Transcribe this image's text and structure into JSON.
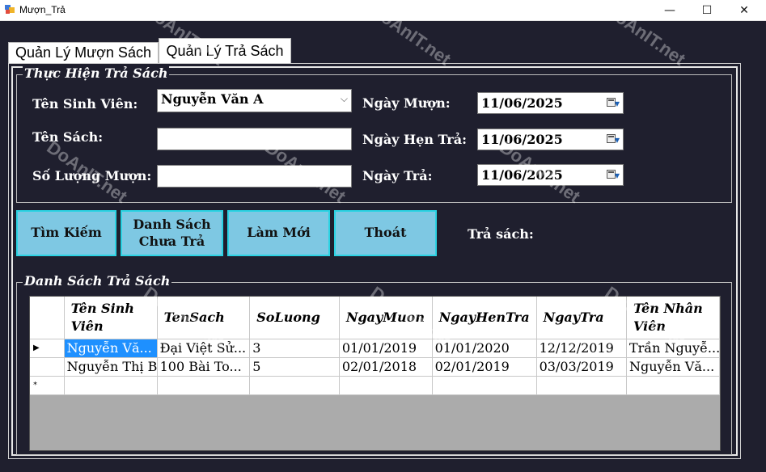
{
  "window": {
    "title": "Mượn_Trả",
    "minimize": "—",
    "maximize": "☐",
    "close": "✕"
  },
  "tabs": [
    {
      "label": "Quản Lý Mượn Sách"
    },
    {
      "label": "Quản Lý Trả Sách"
    }
  ],
  "return_group": {
    "legend": "Thực Hiện Trả Sách",
    "student_label": "Tên Sinh Viên:",
    "student_value": "Nguyễn Văn A",
    "book_label": "Tên Sách:",
    "book_value": "",
    "qty_label": "Số Lượng Mượn:",
    "qty_value": "",
    "borrow_date_label": "Ngày Mượn:",
    "borrow_date_value": "11/06/2025",
    "due_date_label": "Ngày Hẹn Trả:",
    "due_date_value": "11/06/2025",
    "return_date_label": "Ngày Trả:",
    "return_date_value": "11/06/2025"
  },
  "buttons": {
    "search": "Tìm Kiếm",
    "unreturned_line1": "Danh Sách",
    "unreturned_line2": "Chưa Trả",
    "refresh": "Làm Mới",
    "exit": "Thoát",
    "return_label": "Trả sách:"
  },
  "list_group": {
    "legend": "Danh Sách Trả Sách",
    "columns": [
      {
        "line1": "Tên Sinh",
        "line2": "Viên"
      },
      {
        "line1": "TenSach",
        "line2": ""
      },
      {
        "line1": "SoLuong",
        "line2": ""
      },
      {
        "line1": "NgayMuon",
        "line2": ""
      },
      {
        "line1": "NgayHenTra",
        "line2": ""
      },
      {
        "line1": "NgayTra",
        "line2": ""
      },
      {
        "line1": "Tên Nhân",
        "line2": "Viên"
      }
    ],
    "rows": [
      [
        "Nguyễn Vă...",
        "Đại Việt Sử...",
        "3",
        "01/01/2019",
        "01/01/2020",
        "12/12/2019",
        "Trần Nguyễ..."
      ],
      [
        "Nguyễn Thị B",
        "100 Bài To...",
        "5",
        "02/01/2018",
        "02/01/2019",
        "03/03/2019",
        "Nguyễn Vă..."
      ]
    ],
    "current_row_marker": "▶",
    "new_row_marker": "*"
  },
  "icons": {
    "calendar": "calendar-dropdown-icon",
    "combo": "chevron-down-icon"
  },
  "colors": {
    "background": "#1f1f2e",
    "button": "#7ec8e3",
    "button_border": "#2bd3e3",
    "selection": "#1e90ff"
  },
  "watermark": "DoAnIT.net"
}
